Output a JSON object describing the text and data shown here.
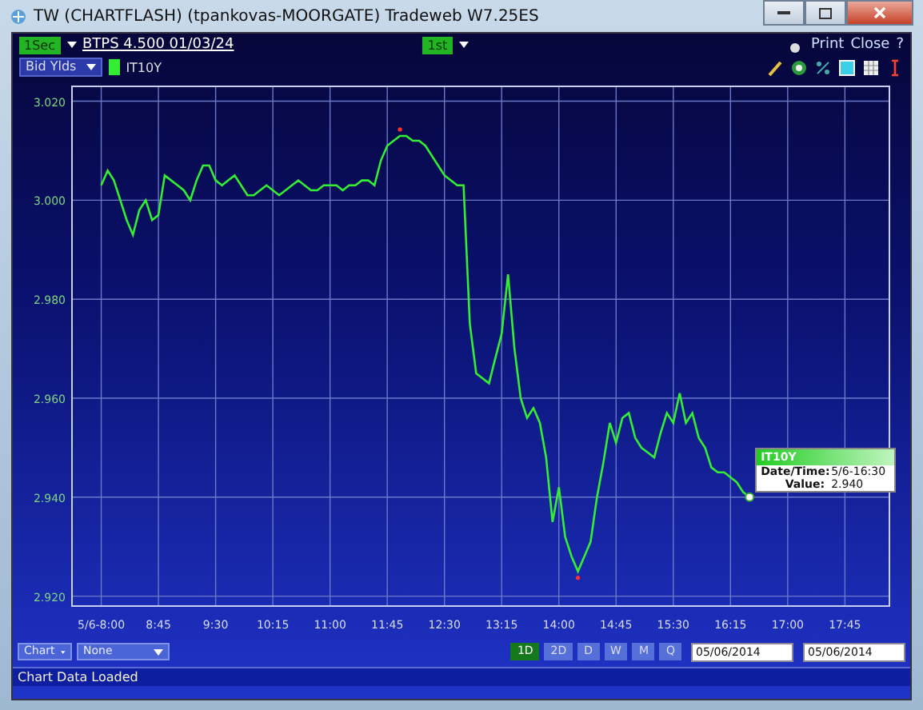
{
  "window": {
    "title": "TW  (CHARTFLASH) (tpankovas-MOORGATE) Tradeweb W7.25ES"
  },
  "toolbar": {
    "interval_tag": "1Sec",
    "instrument": "BTPS  4.500 01/03/24",
    "tab_tag": "1st",
    "actions": [
      "Print",
      "Close",
      "?"
    ]
  },
  "series_bar": {
    "measure": "Bid Ylds"
  },
  "chart": {
    "chart_data": {
      "type": "line",
      "categories": [
        "5/6-8:00",
        null,
        null,
        null,
        null,
        null,
        null,
        null,
        null,
        "8:45",
        null,
        null,
        null,
        null,
        null,
        null,
        null,
        null,
        "9:30",
        null,
        null,
        null,
        null,
        null,
        null,
        null,
        null,
        "10:15",
        null,
        null,
        null,
        null,
        null,
        null,
        null,
        null,
        "11:00",
        null,
        null,
        null,
        null,
        null,
        null,
        null,
        null,
        "11:45",
        null,
        null,
        null,
        null,
        null,
        null,
        null,
        null,
        "12:30",
        null,
        null,
        null,
        null,
        null,
        null,
        null,
        null,
        "13:15",
        null,
        null,
        null,
        null,
        null,
        null,
        null,
        null,
        "14:00",
        null,
        null,
        null,
        null,
        null,
        null,
        null,
        null,
        "14:45",
        null,
        null,
        null,
        null,
        null,
        null,
        null,
        null,
        "15:30",
        null,
        null,
        null,
        null,
        null,
        null,
        null,
        null,
        "16:15",
        null,
        null,
        null,
        null,
        null,
        null,
        null,
        null,
        "17:00",
        null,
        null,
        null,
        null,
        null,
        null,
        null,
        null,
        "17:45"
      ],
      "series": [
        {
          "name": "IT10Y",
          "color": "#33ee33",
          "values": [
            3.003,
            3.006,
            3.004,
            3.0,
            2.996,
            2.993,
            2.998,
            3.0,
            2.996,
            2.997,
            3.005,
            3.004,
            3.003,
            3.002,
            3.0,
            3.004,
            3.007,
            3.007,
            3.004,
            3.003,
            3.004,
            3.005,
            3.003,
            3.001,
            3.001,
            3.002,
            3.003,
            3.002,
            3.001,
            3.002,
            3.003,
            3.004,
            3.003,
            3.002,
            3.002,
            3.003,
            3.003,
            3.003,
            3.002,
            3.003,
            3.003,
            3.004,
            3.004,
            3.003,
            3.008,
            3.011,
            3.012,
            3.013,
            3.013,
            3.012,
            3.012,
            3.011,
            3.009,
            3.007,
            3.005,
            3.004,
            3.003,
            3.003,
            2.975,
            2.965,
            2.964,
            2.963,
            2.968,
            2.973,
            2.985,
            2.97,
            2.96,
            2.956,
            2.958,
            2.955,
            2.948,
            2.935,
            2.942,
            2.932,
            2.928,
            2.925,
            2.928,
            2.931,
            2.94,
            2.947,
            2.955,
            2.951,
            2.956,
            2.957,
            2.952,
            2.95,
            2.949,
            2.948,
            2.953,
            2.957,
            2.955,
            2.961,
            2.955,
            2.957,
            2.952,
            2.95,
            2.946,
            2.945,
            2.945,
            2.944,
            2.943,
            2.941,
            2.94,
            null,
            null,
            null,
            null,
            null,
            null,
            null,
            null,
            null,
            null,
            null,
            null,
            null,
            null,
            null
          ]
        }
      ],
      "grid": true,
      "ylim": [
        2.918,
        3.023
      ],
      "yticks": [
        {
          "value": 2.92,
          "label": "2.920"
        },
        {
          "value": 2.94,
          "label": "2.940"
        },
        {
          "value": 2.96,
          "label": "2.960"
        },
        {
          "value": 2.98,
          "label": "2.980"
        },
        {
          "value": 3.0,
          "label": "3.000"
        },
        {
          "value": 3.02,
          "label": "3.020"
        }
      ]
    },
    "tooltip": {
      "title": "IT10Y",
      "rows": [
        {
          "label": "Date/Time:",
          "value": "5/6-16:30"
        },
        {
          "label": "Value:",
          "value": "2.940"
        }
      ]
    }
  },
  "bottom": {
    "dropdowns": [
      "Chart",
      "None"
    ],
    "periods": [
      {
        "label": "1D",
        "selected": true
      },
      {
        "label": "2D",
        "selected": false
      },
      {
        "label": "D",
        "selected": false
      },
      {
        "label": "W",
        "selected": false
      },
      {
        "label": "M",
        "selected": false
      },
      {
        "label": "Q",
        "selected": false
      }
    ],
    "dates": [
      "05/06/2014",
      "05/06/2014"
    ]
  },
  "status_bar": {
    "text": "Chart Data Loaded"
  }
}
